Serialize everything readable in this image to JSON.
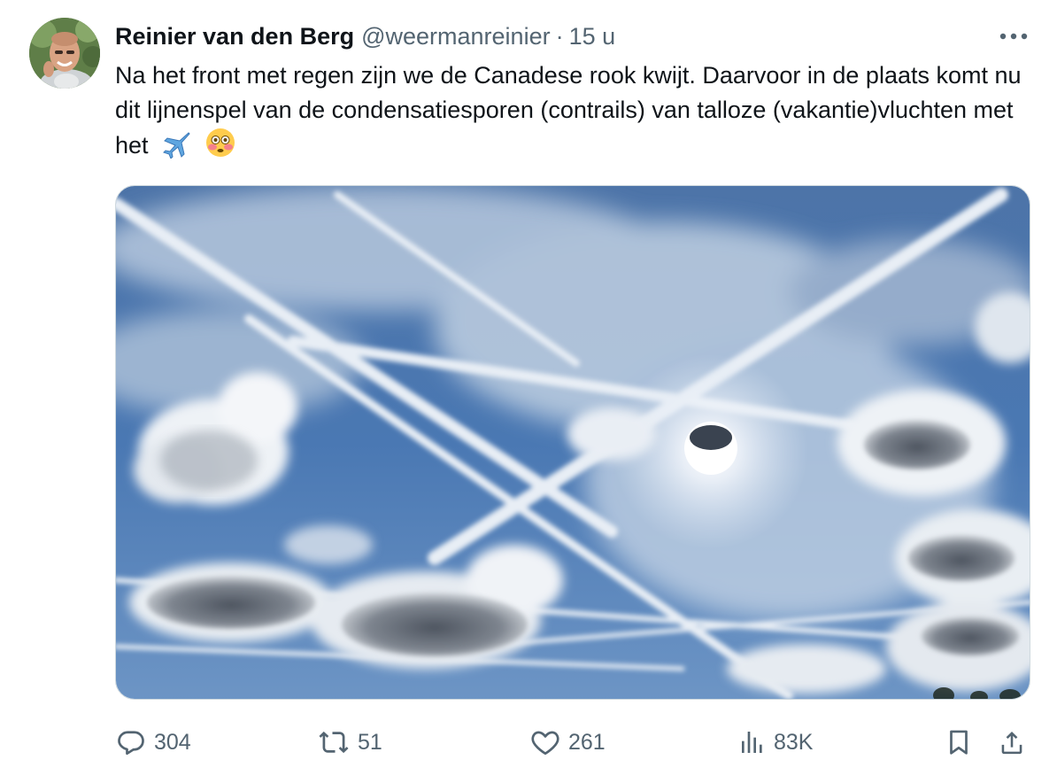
{
  "author": {
    "name": "Reinier van den Berg",
    "handle": "@weermanreinier",
    "separator": "·",
    "time": "15 u"
  },
  "tweet": {
    "text": "Na het front met regen zijn we de Canadese rook kwijt. Daarvoor in de plaats komt nu dit lijnenspel van de condensatiesporen (contrails) van talloze (vakantie)vluchten met het",
    "emojis": [
      "airplane-emoji",
      "flushed-face-emoji"
    ]
  },
  "media": {
    "type": "photo",
    "subject": "sky-with-contrails-and-clouds"
  },
  "actions": {
    "replies": "304",
    "reposts": "51",
    "likes": "261",
    "views": "83K"
  },
  "colors": {
    "text_primary": "#0f1419",
    "text_secondary": "#536471",
    "border": "#cfd9de",
    "sky": "#3f6ea6"
  }
}
